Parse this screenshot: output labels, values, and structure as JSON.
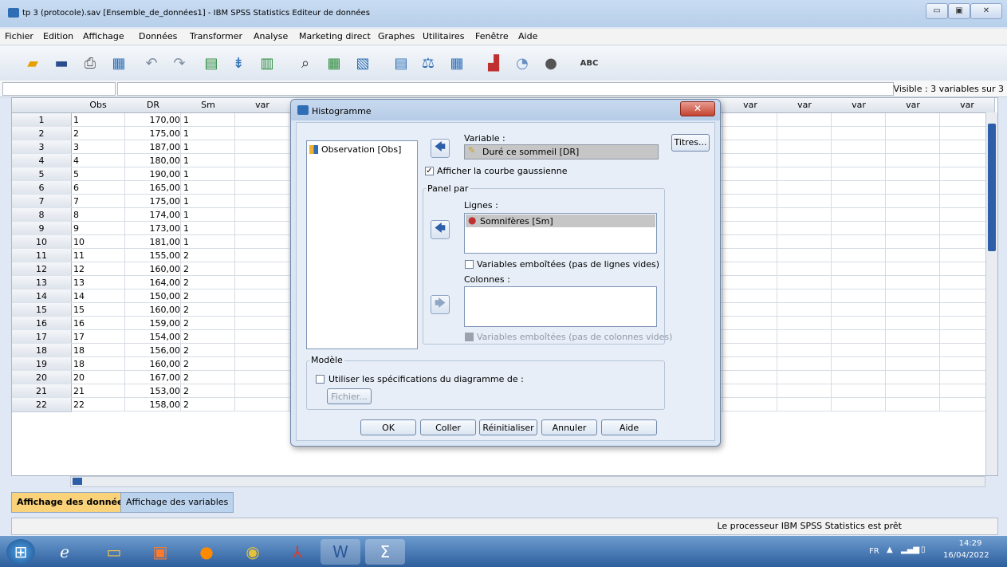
{
  "window": {
    "title": "tp 3 (protocole).sav [Ensemble_de_données1] - IBM SPSS Statistics Editeur de données",
    "min": "▭",
    "max": "▣",
    "close": "✕"
  },
  "menu": [
    "Fichier",
    "Edition",
    "Affichage",
    "Données",
    "Transformer",
    "Analyse",
    "Marketing direct",
    "Graphes",
    "Utilitaires",
    "Fenêtre",
    "Aide"
  ],
  "toolbar": {
    "icons": [
      "open-folder-icon",
      "save-icon",
      "print-icon",
      "dialog-recall-icon",
      "undo-icon",
      "redo-icon",
      "goto-case-icon",
      "goto-variable-icon",
      "variables-icon",
      "find-icon",
      "insert-cases-icon",
      "insert-variable-icon",
      "split-file-icon",
      "weight-cases-icon",
      "select-cases-icon",
      "value-labels-icon",
      "use-sets-icon",
      "show-all-variables-icon",
      "spell-check-icon"
    ],
    "spell_label": "ABC"
  },
  "editbar": {
    "visible": "Visible : 3 variables sur 3"
  },
  "grid": {
    "columns": [
      "Obs",
      "DR",
      "Sm",
      "var",
      "var",
      "var",
      "var",
      "var",
      "var",
      "var",
      "var",
      "var",
      "var",
      "var",
      "var",
      "var",
      "var"
    ],
    "rows": [
      {
        "n": "1",
        "obs": "1",
        "dr": "170,00",
        "sm": "1"
      },
      {
        "n": "2",
        "obs": "2",
        "dr": "175,00",
        "sm": "1"
      },
      {
        "n": "3",
        "obs": "3",
        "dr": "187,00",
        "sm": "1"
      },
      {
        "n": "4",
        "obs": "4",
        "dr": "180,00",
        "sm": "1"
      },
      {
        "n": "5",
        "obs": "5",
        "dr": "190,00",
        "sm": "1"
      },
      {
        "n": "6",
        "obs": "6",
        "dr": "165,00",
        "sm": "1"
      },
      {
        "n": "7",
        "obs": "7",
        "dr": "175,00",
        "sm": "1"
      },
      {
        "n": "8",
        "obs": "8",
        "dr": "174,00",
        "sm": "1"
      },
      {
        "n": "9",
        "obs": "9",
        "dr": "173,00",
        "sm": "1"
      },
      {
        "n": "10",
        "obs": "10",
        "dr": "181,00",
        "sm": "1"
      },
      {
        "n": "11",
        "obs": "11",
        "dr": "155,00",
        "sm": "2"
      },
      {
        "n": "12",
        "obs": "12",
        "dr": "160,00",
        "sm": "2"
      },
      {
        "n": "13",
        "obs": "13",
        "dr": "164,00",
        "sm": "2"
      },
      {
        "n": "14",
        "obs": "14",
        "dr": "150,00",
        "sm": "2"
      },
      {
        "n": "15",
        "obs": "15",
        "dr": "160,00",
        "sm": "2"
      },
      {
        "n": "16",
        "obs": "16",
        "dr": "159,00",
        "sm": "2"
      },
      {
        "n": "17",
        "obs": "17",
        "dr": "154,00",
        "sm": "2"
      },
      {
        "n": "18",
        "obs": "18",
        "dr": "156,00",
        "sm": "2"
      },
      {
        "n": "19",
        "obs": "18",
        "dr": "160,00",
        "sm": "2"
      },
      {
        "n": "20",
        "obs": "20",
        "dr": "167,00",
        "sm": "2"
      },
      {
        "n": "21",
        "obs": "21",
        "dr": "153,00",
        "sm": "2"
      },
      {
        "n": "22",
        "obs": "22",
        "dr": "158,00",
        "sm": "2"
      }
    ]
  },
  "tabs": {
    "data_view": "Affichage des données",
    "variable_view": "Affichage des variables"
  },
  "status": {
    "message": "Le processeur IBM SPSS Statistics  est prêt"
  },
  "taskbar": {
    "lang": "FR",
    "time": "14:29",
    "date": "16/04/2022"
  },
  "dialog": {
    "title": "Histogramme",
    "source_items": [
      "Observation [Obs]"
    ],
    "variable_label": "Variable :",
    "variable_value": "Duré ce sommeil [DR]",
    "titles_button": "Titres...",
    "show_normal_curve": "Afficher la courbe gaussienne",
    "panel_by": "Panel par",
    "rows_label": "Lignes :",
    "rows_value": "Somnifères [Sm]",
    "nest_rows": "Variables emboîtées (pas de lignes vides)",
    "columns_label": "Colonnes :",
    "nest_cols": "Variables emboîtées (pas de colonnes vides)",
    "model_label": "Modèle",
    "use_spec": "Utiliser les spécifications du diagramme de :",
    "file_button": "Fichier...",
    "buttons": {
      "ok": "OK",
      "paste": "Coller",
      "reset": "Réinitialiser",
      "cancel": "Annuler",
      "help": "Aide"
    }
  }
}
